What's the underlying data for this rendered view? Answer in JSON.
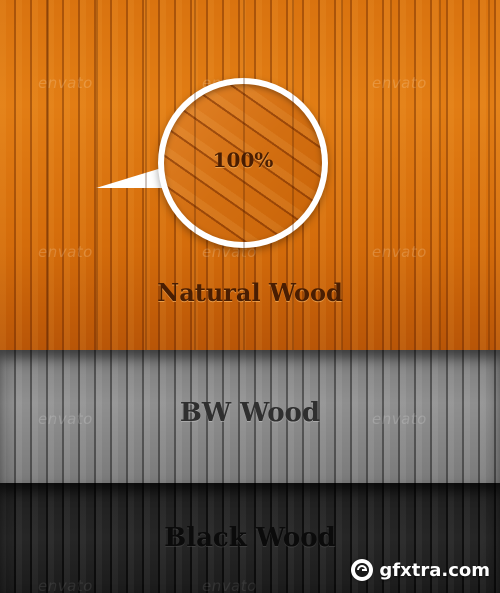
{
  "panels": [
    {
      "id": "natural",
      "label": "Natural Wood",
      "color": "#d9730f"
    },
    {
      "id": "bw",
      "label": "BW Wood",
      "color": "#8a8a8a"
    },
    {
      "id": "black",
      "label": "Black Wood",
      "color": "#222222"
    }
  ],
  "bubble": {
    "text": "100%"
  },
  "watermark_text": "envato",
  "site_mark": {
    "text": "gfxtra.com",
    "icon": "gfxtra-logo-icon"
  }
}
